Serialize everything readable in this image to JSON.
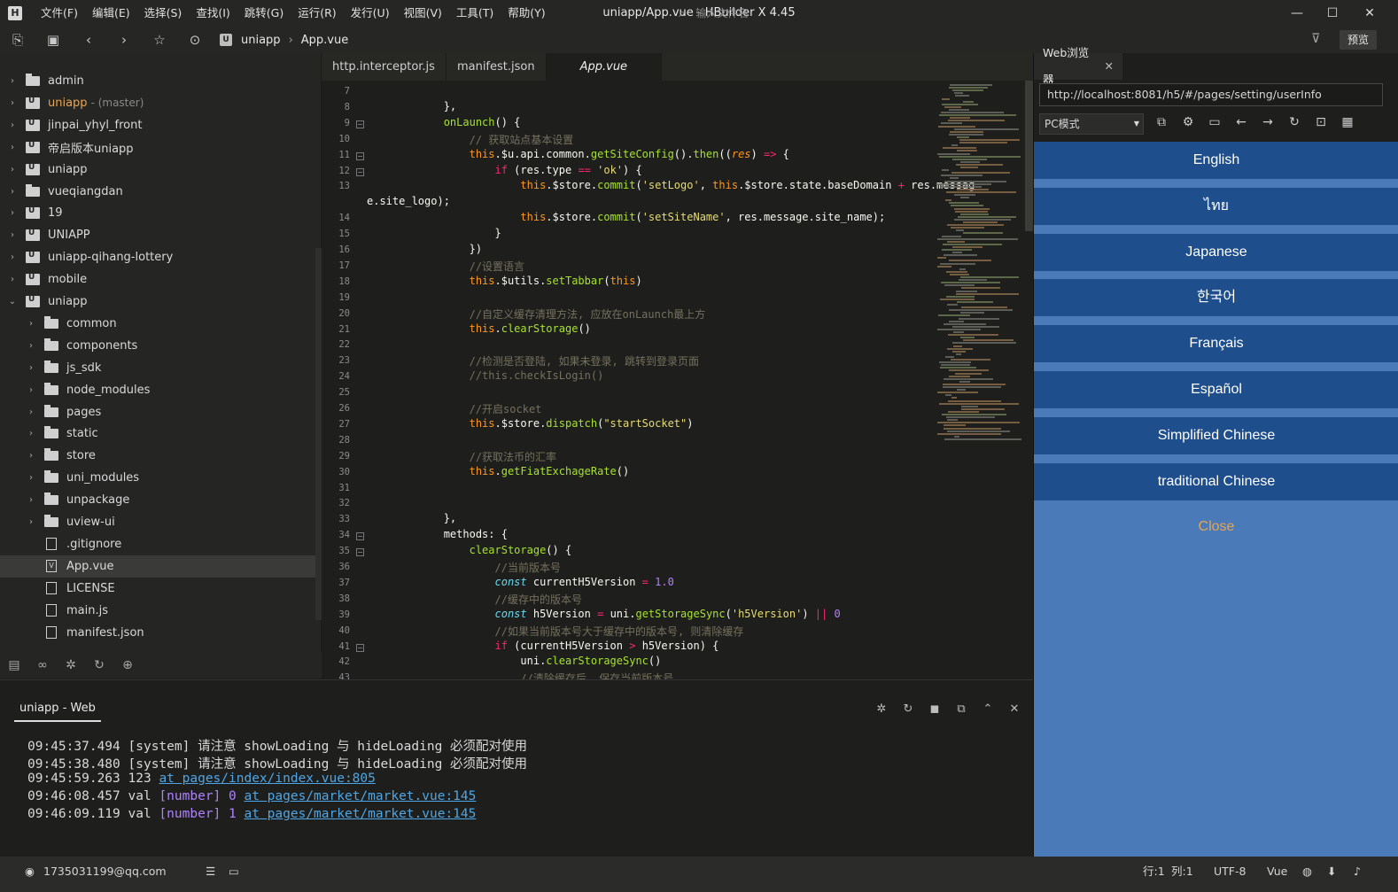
{
  "window": {
    "title": "uniapp/App.vue - HBuilder X 4.45",
    "logo": "H",
    "minimize": "—",
    "maximize": "☐",
    "close": "✕"
  },
  "menu": [
    "文件(F)",
    "编辑(E)",
    "选择(S)",
    "查找(I)",
    "跳转(G)",
    "运行(R)",
    "发行(U)",
    "视图(V)",
    "工具(T)",
    "帮助(Y)"
  ],
  "toolbar": {
    "breadcrumb_project": "uniapp",
    "breadcrumb_file": "App.vue",
    "file_search_placeholder": "输入文件名",
    "preview_label": "预览"
  },
  "explorer": {
    "items": [
      {
        "label": "admin",
        "type": "folder",
        "level": 0,
        "chevron": "›"
      },
      {
        "label": "uniapp",
        "tag": "- (master)",
        "type": "project",
        "level": 0,
        "chevron": "›",
        "highlight": true
      },
      {
        "label": "jinpai_yhyl_front",
        "type": "project",
        "level": 0,
        "chevron": "›"
      },
      {
        "label": "帝启版本uniapp",
        "type": "project",
        "level": 0,
        "chevron": "›"
      },
      {
        "label": "uniapp",
        "type": "project",
        "level": 0,
        "chevron": "›"
      },
      {
        "label": "vueqiangdan",
        "type": "folder",
        "level": 0,
        "chevron": "›"
      },
      {
        "label": "19",
        "type": "project",
        "level": 0,
        "chevron": "›"
      },
      {
        "label": "UNIAPP",
        "type": "project",
        "level": 0,
        "chevron": "›"
      },
      {
        "label": "uniapp-qihang-lottery",
        "type": "project",
        "level": 0,
        "chevron": "›"
      },
      {
        "label": "mobile",
        "type": "project",
        "level": 0,
        "chevron": "›"
      },
      {
        "label": "uniapp",
        "type": "project",
        "level": 0,
        "chevron": "⌄"
      },
      {
        "label": "common",
        "type": "folder",
        "level": 1,
        "chevron": "›"
      },
      {
        "label": "components",
        "type": "folder",
        "level": 1,
        "chevron": "›"
      },
      {
        "label": "js_sdk",
        "type": "folder",
        "level": 1,
        "chevron": "›"
      },
      {
        "label": "node_modules",
        "type": "folder",
        "level": 1,
        "chevron": "›"
      },
      {
        "label": "pages",
        "type": "folder",
        "level": 1,
        "chevron": "›"
      },
      {
        "label": "static",
        "type": "folder",
        "level": 1,
        "chevron": "›"
      },
      {
        "label": "store",
        "type": "folder",
        "level": 1,
        "chevron": "›"
      },
      {
        "label": "uni_modules",
        "type": "folder",
        "level": 1,
        "chevron": "›"
      },
      {
        "label": "unpackage",
        "type": "folder",
        "level": 1,
        "chevron": "›"
      },
      {
        "label": "uview-ui",
        "type": "folder",
        "level": 1,
        "chevron": "›"
      },
      {
        "label": ".gitignore",
        "type": "file",
        "level": 1,
        "chevron": ""
      },
      {
        "label": "App.vue",
        "type": "vfile",
        "level": 1,
        "chevron": "",
        "selected": true
      },
      {
        "label": "LICENSE",
        "type": "file",
        "level": 1,
        "chevron": ""
      },
      {
        "label": "main.js",
        "type": "file",
        "level": 1,
        "chevron": ""
      },
      {
        "label": "manifest.json",
        "type": "file",
        "level": 1,
        "chevron": ""
      }
    ]
  },
  "editor": {
    "tabs": [
      "http.interceptor.js",
      "manifest.json",
      "App.vue"
    ],
    "active_tab": "App.vue",
    "line_numbers": [
      "7",
      "8",
      "9",
      "10",
      "11",
      "12",
      "13",
      "",
      "14",
      "15",
      "16",
      "17",
      "18",
      "19",
      "20",
      "21",
      "22",
      "23",
      "24",
      "25",
      "26",
      "27",
      "28",
      "29",
      "30",
      "31",
      "32",
      "33",
      "34",
      "35",
      "36",
      "37",
      "38",
      "39",
      "40",
      "41",
      "42",
      "43"
    ],
    "lines": [
      [],
      [
        [
          "p",
          "            },"
        ]
      ],
      [
        [
          "p",
          "            "
        ],
        [
          "fn",
          "onLaunch"
        ],
        [
          "p",
          "() {"
        ]
      ],
      [
        [
          "p",
          "                "
        ],
        [
          "cm",
          "// 获取站点基本设置"
        ]
      ],
      [
        [
          "p",
          "                "
        ],
        [
          "th",
          "this"
        ],
        [
          "p",
          ".$u.api.common."
        ],
        [
          "fn",
          "getSiteConfig"
        ],
        [
          "p",
          "()."
        ],
        [
          "fn",
          "then"
        ],
        [
          "p",
          "(("
        ],
        [
          "it",
          "res"
        ],
        [
          "p",
          ") "
        ],
        [
          "kw",
          "=>"
        ],
        [
          "p",
          " {"
        ]
      ],
      [
        [
          "p",
          "                    "
        ],
        [
          "kw",
          "if"
        ],
        [
          "p",
          " (res.type "
        ],
        [
          "kw",
          "=="
        ],
        [
          "p",
          " "
        ],
        [
          "str",
          "'ok'"
        ],
        [
          "p",
          ") {"
        ]
      ],
      [
        [
          "p",
          "                        "
        ],
        [
          "th",
          "this"
        ],
        [
          "p",
          ".$store."
        ],
        [
          "fn",
          "commit"
        ],
        [
          "p",
          "("
        ],
        [
          "str",
          "'setLogo'"
        ],
        [
          "p",
          ", "
        ],
        [
          "th",
          "this"
        ],
        [
          "p",
          ".$store.state.baseDomain "
        ],
        [
          "kw",
          "+"
        ],
        [
          "p",
          " res.messag"
        ]
      ],
      [
        [
          "p",
          "e.site_logo);"
        ]
      ],
      [
        [
          "p",
          "                        "
        ],
        [
          "th",
          "this"
        ],
        [
          "p",
          ".$store."
        ],
        [
          "fn",
          "commit"
        ],
        [
          "p",
          "("
        ],
        [
          "str",
          "'setSiteName'"
        ],
        [
          "p",
          ", res.message.site_name);"
        ]
      ],
      [
        [
          "p",
          "                    }"
        ]
      ],
      [
        [
          "p",
          "                })"
        ]
      ],
      [
        [
          "p",
          "                "
        ],
        [
          "cm",
          "//设置语言"
        ]
      ],
      [
        [
          "p",
          "                "
        ],
        [
          "th",
          "this"
        ],
        [
          "p",
          ".$utils."
        ],
        [
          "fn",
          "setTabbar"
        ],
        [
          "p",
          "("
        ],
        [
          "th",
          "this"
        ],
        [
          "p",
          ")"
        ]
      ],
      [],
      [
        [
          "p",
          "                "
        ],
        [
          "cm",
          "//自定义缓存清理方法, 应放在onLaunch最上方"
        ]
      ],
      [
        [
          "p",
          "                "
        ],
        [
          "th",
          "this"
        ],
        [
          "p",
          "."
        ],
        [
          "fn",
          "clearStorage"
        ],
        [
          "p",
          "()"
        ]
      ],
      [],
      [
        [
          "p",
          "                "
        ],
        [
          "cm",
          "//检测是否登陆, 如果未登录, 跳转到登录页面"
        ]
      ],
      [
        [
          "p",
          "                "
        ],
        [
          "cm",
          "//this.checkIsLogin()"
        ]
      ],
      [],
      [
        [
          "p",
          "                "
        ],
        [
          "cm",
          "//开启socket"
        ]
      ],
      [
        [
          "p",
          "                "
        ],
        [
          "th",
          "this"
        ],
        [
          "p",
          ".$store."
        ],
        [
          "fn",
          "dispatch"
        ],
        [
          "p",
          "("
        ],
        [
          "str",
          "\"startSocket\""
        ],
        [
          "p",
          ")"
        ]
      ],
      [],
      [
        [
          "p",
          "                "
        ],
        [
          "cm",
          "//获取法币的汇率"
        ]
      ],
      [
        [
          "p",
          "                "
        ],
        [
          "th",
          "this"
        ],
        [
          "p",
          "."
        ],
        [
          "fn",
          "getFiatExchageRate"
        ],
        [
          "p",
          "()"
        ]
      ],
      [],
      [],
      [
        [
          "p",
          "            },"
        ]
      ],
      [
        [
          "p",
          "            methods: {"
        ]
      ],
      [
        [
          "p",
          "                "
        ],
        [
          "fn",
          "clearStorage"
        ],
        [
          "p",
          "() {"
        ]
      ],
      [
        [
          "p",
          "                    "
        ],
        [
          "cm",
          "//当前版本号"
        ]
      ],
      [
        [
          "p",
          "                    "
        ],
        [
          "cf",
          "const"
        ],
        [
          "p",
          " currentH5Version "
        ],
        [
          "kw",
          "="
        ],
        [
          "p",
          " "
        ],
        [
          "num",
          "1.0"
        ]
      ],
      [
        [
          "p",
          "                    "
        ],
        [
          "cm",
          "//缓存中的版本号"
        ]
      ],
      [
        [
          "p",
          "                    "
        ],
        [
          "cf",
          "const"
        ],
        [
          "p",
          " h5Version "
        ],
        [
          "kw",
          "="
        ],
        [
          "p",
          " uni."
        ],
        [
          "fn",
          "getStorageSync"
        ],
        [
          "p",
          "("
        ],
        [
          "str",
          "'h5Version'"
        ],
        [
          "p",
          ") "
        ],
        [
          "kw",
          "||"
        ],
        [
          "p",
          " "
        ],
        [
          "num",
          "0"
        ]
      ],
      [
        [
          "p",
          "                    "
        ],
        [
          "cm",
          "//如果当前版本号大于缓存中的版本号, 则清除缓存"
        ]
      ],
      [
        [
          "p",
          "                    "
        ],
        [
          "kw",
          "if"
        ],
        [
          "p",
          " (currentH5Version "
        ],
        [
          "kw",
          ">"
        ],
        [
          "p",
          " h5Version) {"
        ]
      ],
      [
        [
          "p",
          "                        uni."
        ],
        [
          "fn",
          "clearStorageSync"
        ],
        [
          "p",
          "()"
        ]
      ],
      [
        [
          "p",
          "                        "
        ],
        [
          "cm",
          "//清除缓存后, 保存当前版本号"
        ]
      ]
    ]
  },
  "web_browser": {
    "tab_label": "Web浏览器",
    "tab_close": "✕",
    "url": "http://localhost:8081/h5/#/pages/setting/userInfo",
    "mode": "PC模式",
    "languages": [
      "English",
      "ไทย",
      "Japanese",
      "한국어",
      "Français",
      "Español",
      "Simplified Chinese",
      "traditional Chinese"
    ],
    "close_label": "Close",
    "colors": {
      "button": "#1e4e8c",
      "background": "#4a7ab8",
      "close_text": "#e6a454"
    }
  },
  "console": {
    "title": "uniapp - Web",
    "logs": [
      {
        "time": "09:45:37.494",
        "text": "[system] 请注意 showLoading 与 hideLoading 必须配对使用",
        "type_tag": "",
        "value": "",
        "link": ""
      },
      {
        "time": "09:45:38.480",
        "text": "[system] 请注意 showLoading 与 hideLoading 必须配对使用",
        "type_tag": "",
        "value": "",
        "link": ""
      },
      {
        "time": "09:45:59.263",
        "text": "123",
        "type_tag": "",
        "value": "",
        "link": "at pages/index/index.vue:805"
      },
      {
        "time": "09:46:08.457",
        "text": "val",
        "type_tag": "[number]",
        "value": "0",
        "link": "at pages/market/market.vue:145"
      },
      {
        "time": "09:46:09.119",
        "text": "val",
        "type_tag": "[number]",
        "value": "1",
        "link": "at pages/market/market.vue:145"
      }
    ]
  },
  "statusbar": {
    "user": "1735031199@qq.com",
    "row": "行:1",
    "col": "列:1",
    "encoding": "UTF-8",
    "language": "Vue"
  }
}
